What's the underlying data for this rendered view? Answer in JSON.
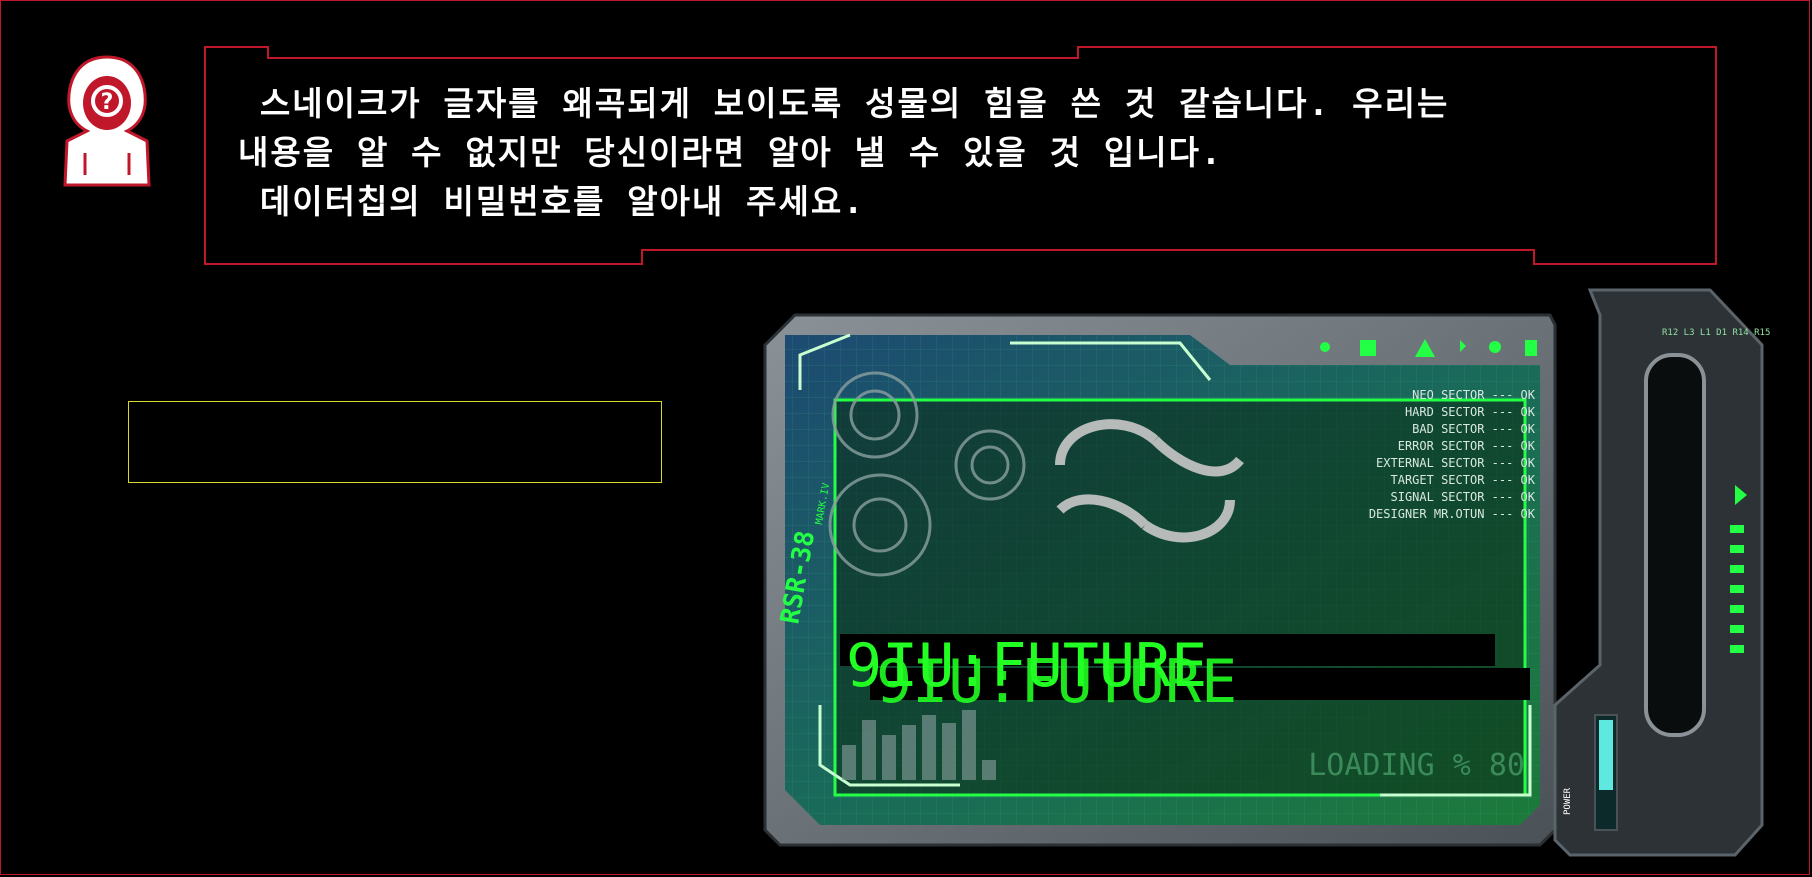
{
  "dialog": {
    "lines": [
      " 스네이크가 글자를 왜곡되게 보이도록 성물의 힘을 쓴 것 같습니다. 우리는",
      "내용을 알 수 없지만 당신이라면 알아 낼 수 있을 것 입니다.",
      " 데이터칩의 비밀번호를 알아내 주세요."
    ]
  },
  "answer": {
    "value": ""
  },
  "device": {
    "model": "RSR-38",
    "model_sub": "MARK.IV",
    "sectors_top": [
      "NEO SECTOR --- OK",
      "HARD SECTOR --- OK",
      "BAD SECTOR --- OK",
      "ERROR SECTOR --- OK",
      "EXTERNAL SECTOR --- OK",
      "TARGET SECTOR --- OK",
      "SIGNAL SECTOR --- OK",
      "DESIGNER MR.OTUN --- OK"
    ],
    "loading": "LOADING % 80",
    "cipher": "9IU:FUTURE",
    "power": "POWER",
    "side_labels": "R12 L3 L1 D1 R14 R15"
  },
  "colors": {
    "border": "#c0182a",
    "input_border": "#d9d92a",
    "glow": "#22ff22"
  }
}
